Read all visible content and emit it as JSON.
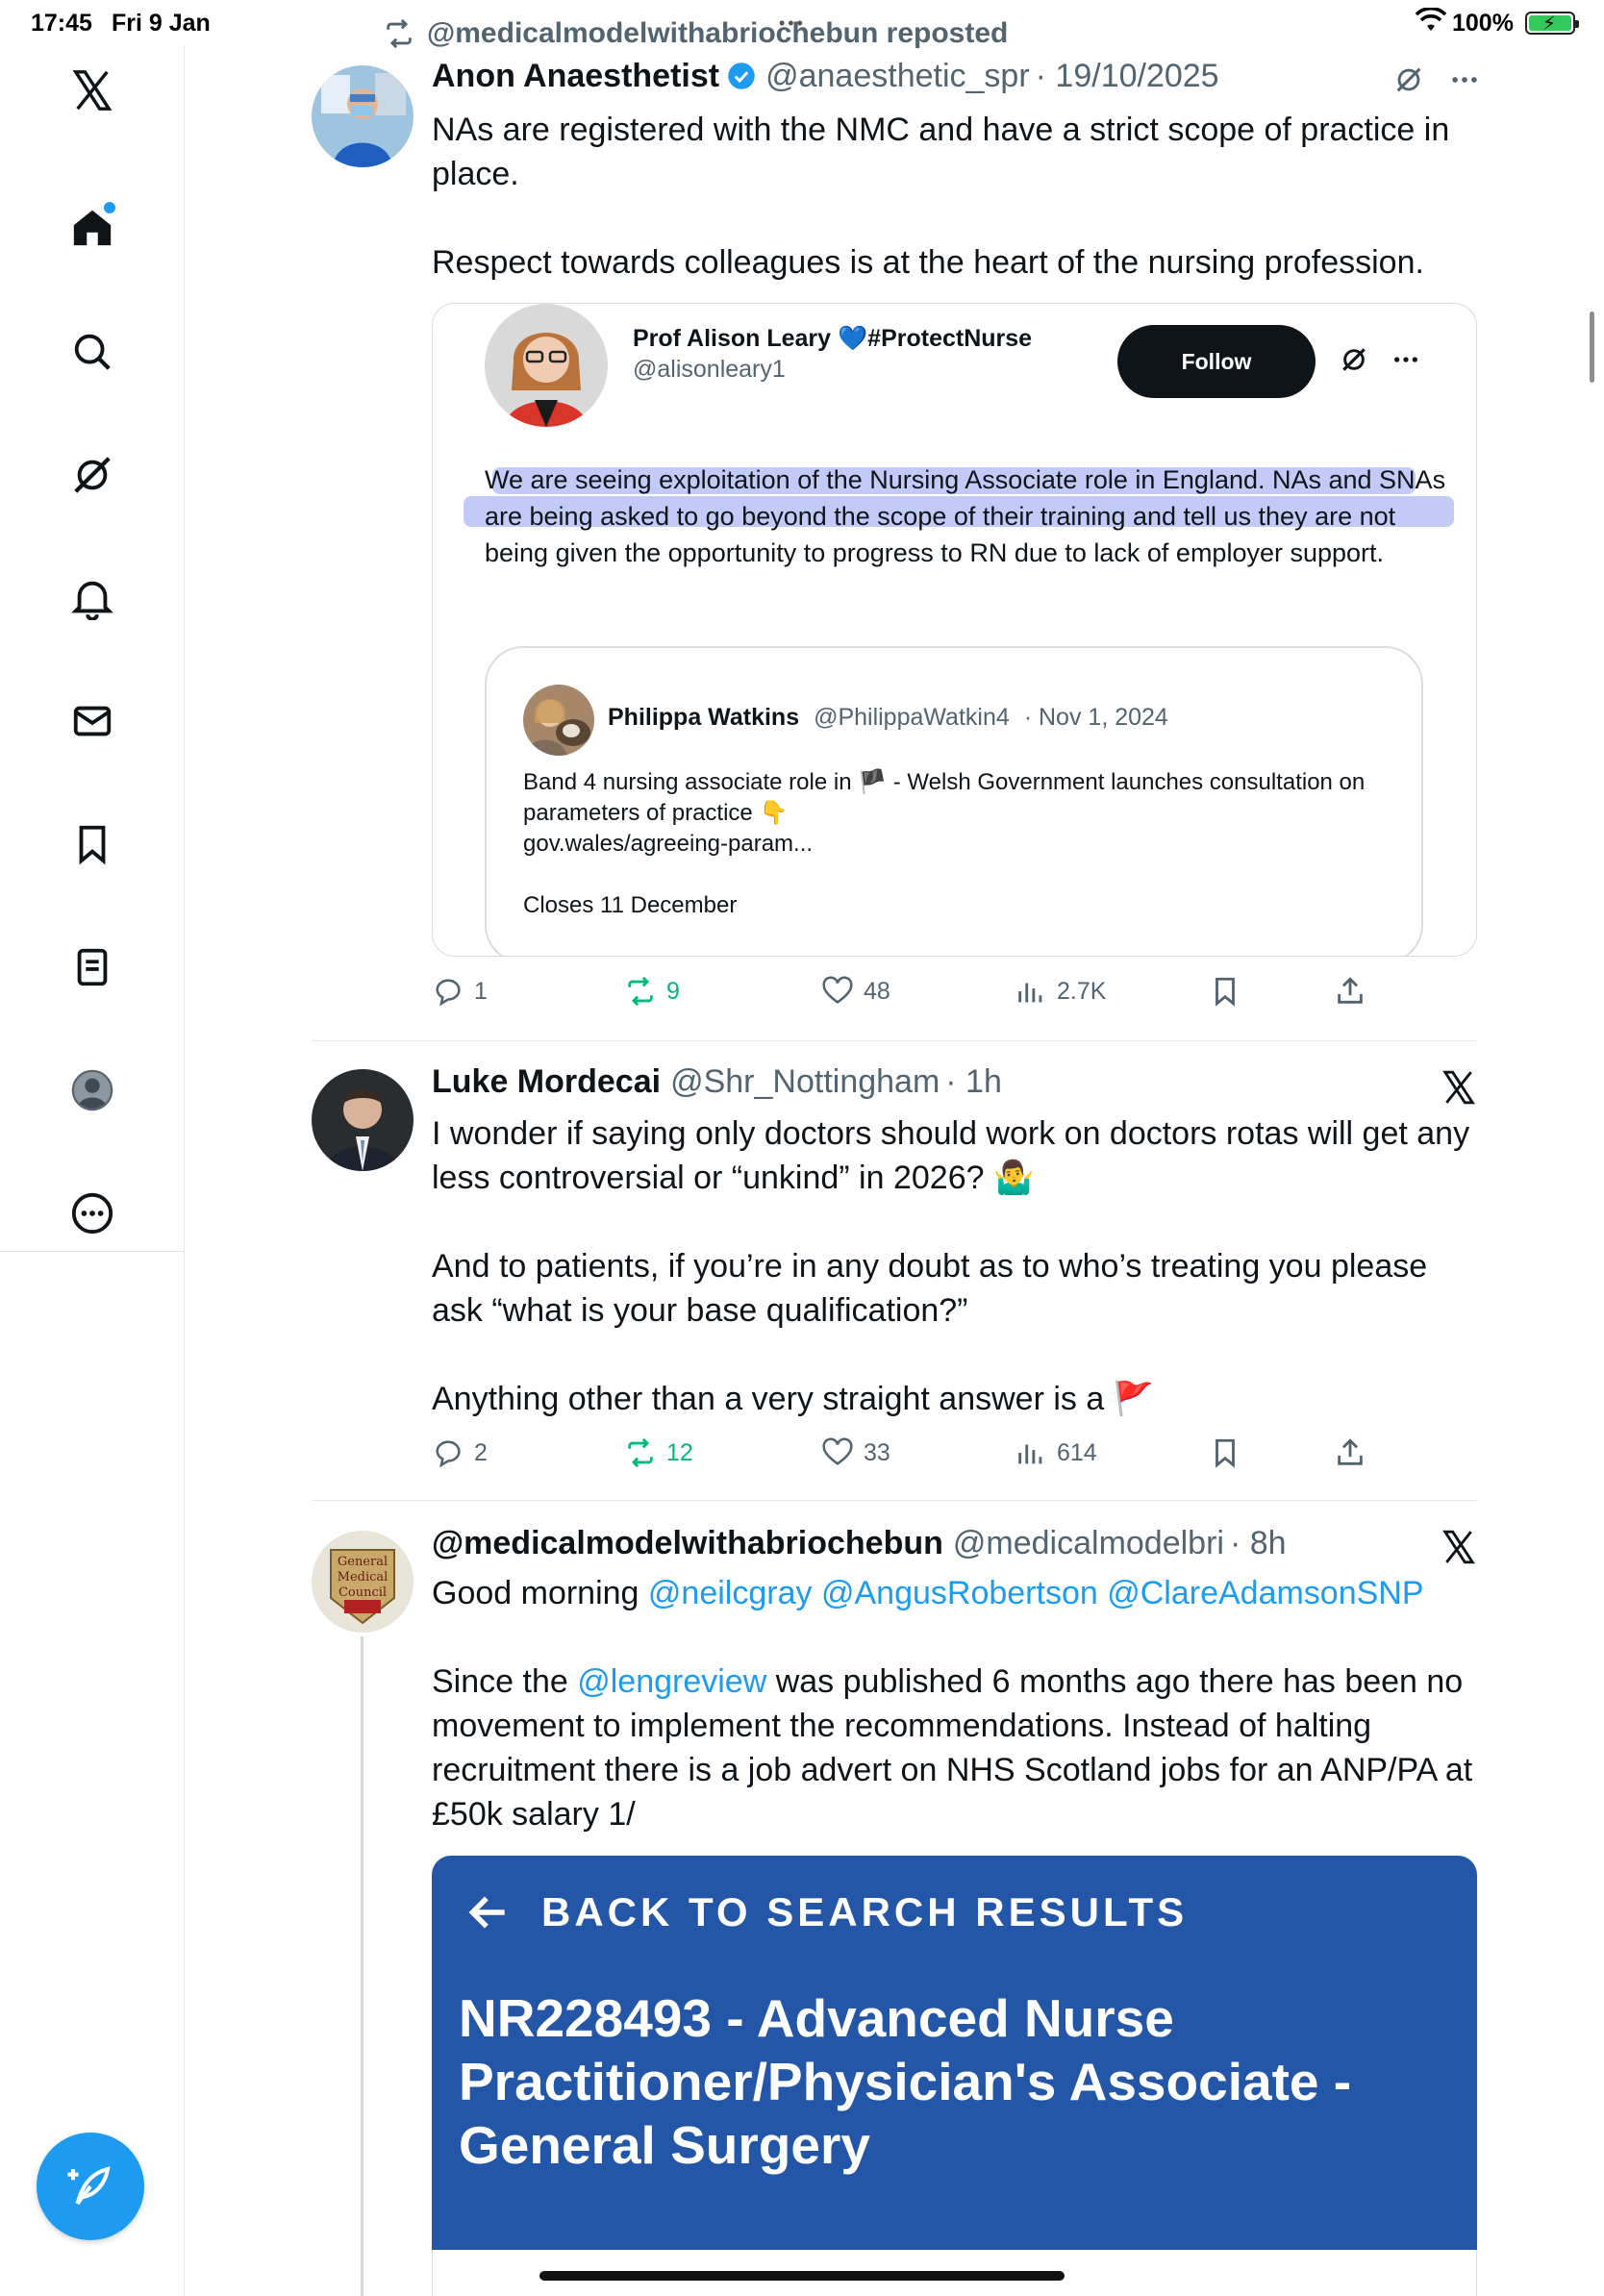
{
  "status_bar": {
    "time": "17:45",
    "date": "Fri 9 Jan",
    "battery": "100%"
  },
  "sidebar": {
    "items": [
      "x-logo",
      "home",
      "search",
      "grok",
      "notifications",
      "messages",
      "bookmarks",
      "lists",
      "profile",
      "more"
    ]
  },
  "repost_banner": "@medicalmodelwithabriochebun reposted",
  "tweet1": {
    "name": "Anon Anaesthetist",
    "handle": "@anaesthetic_spr",
    "date": "· 19/10/2025",
    "paragraphs": [
      "NAs are registered with the NMC and have a strict scope of practice in place.",
      "Respect towards colleagues is at the heart of the nursing profession."
    ],
    "quote": {
      "name": "Prof Alison Leary",
      "name_suffix": "#ProtectNurse",
      "handle": "@alisonleary1",
      "follow_label": "Follow",
      "text": "We are seeing exploitation of the Nursing Associate role in England. NAs and SNAs are being asked to go beyond the scope of their training and tell us they are not being given the opportunity to progress to RN due to lack of employer support.",
      "inner": {
        "name": "Philippa Watkins",
        "handle": "@PhilippaWatkin4",
        "date": "· Nov 1, 2024",
        "line1": "Band 4 nursing associate role in 🏴 - Welsh Government launches consultation on parameters of practice 👇",
        "line2": "gov.wales/agreeing-param...",
        "closes": "Closes 11 December"
      }
    },
    "stats": {
      "replies": "1",
      "reposts": "9",
      "likes": "48",
      "views": "2.7K"
    }
  },
  "tweet2": {
    "name": "Luke Mordecai",
    "handle": "@Shr_Nottingham",
    "date": "· 1h",
    "paragraphs": [
      "I wonder if saying only doctors should work on doctors rotas will get any less controversial or “unkind” in 2026? 🤷‍♂️",
      "And to patients, if you’re in any doubt as to who’s treating you please ask “what is your base qualification?”",
      "Anything other than a very straight answer is a 🚩"
    ],
    "stats": {
      "replies": "2",
      "reposts": "12",
      "likes": "33",
      "views": "614"
    }
  },
  "tweet3": {
    "name": "@medicalmodelwithabriochebun",
    "handle": "@medicalmodelbri",
    "date": "· 8h",
    "greeting": "Good morning",
    "mentions": [
      "@neilcgray",
      "@AngusRobertson",
      "@ClareAdamsonSNP"
    ],
    "p2_pre": "Since the",
    "p2_mention": "@lengreview",
    "p2_post": "was published 6 months ago there has been no movement to implement the recommendations. Instead of halting recruitment there is a job advert on NHS Scotland jobs for an ANP/PA at £50k salary 1/",
    "job_card": {
      "back_label": "BACK TO SEARCH RESULTS",
      "title": "NR228493 - Advanced Nurse Practitioner/Physician's Associate - General Surgery"
    }
  },
  "colors": {
    "accent": "#1d9bf0",
    "repost_green": "#00ba7c",
    "job_blue": "#2356a7",
    "highlight": "#7b8cf0"
  }
}
